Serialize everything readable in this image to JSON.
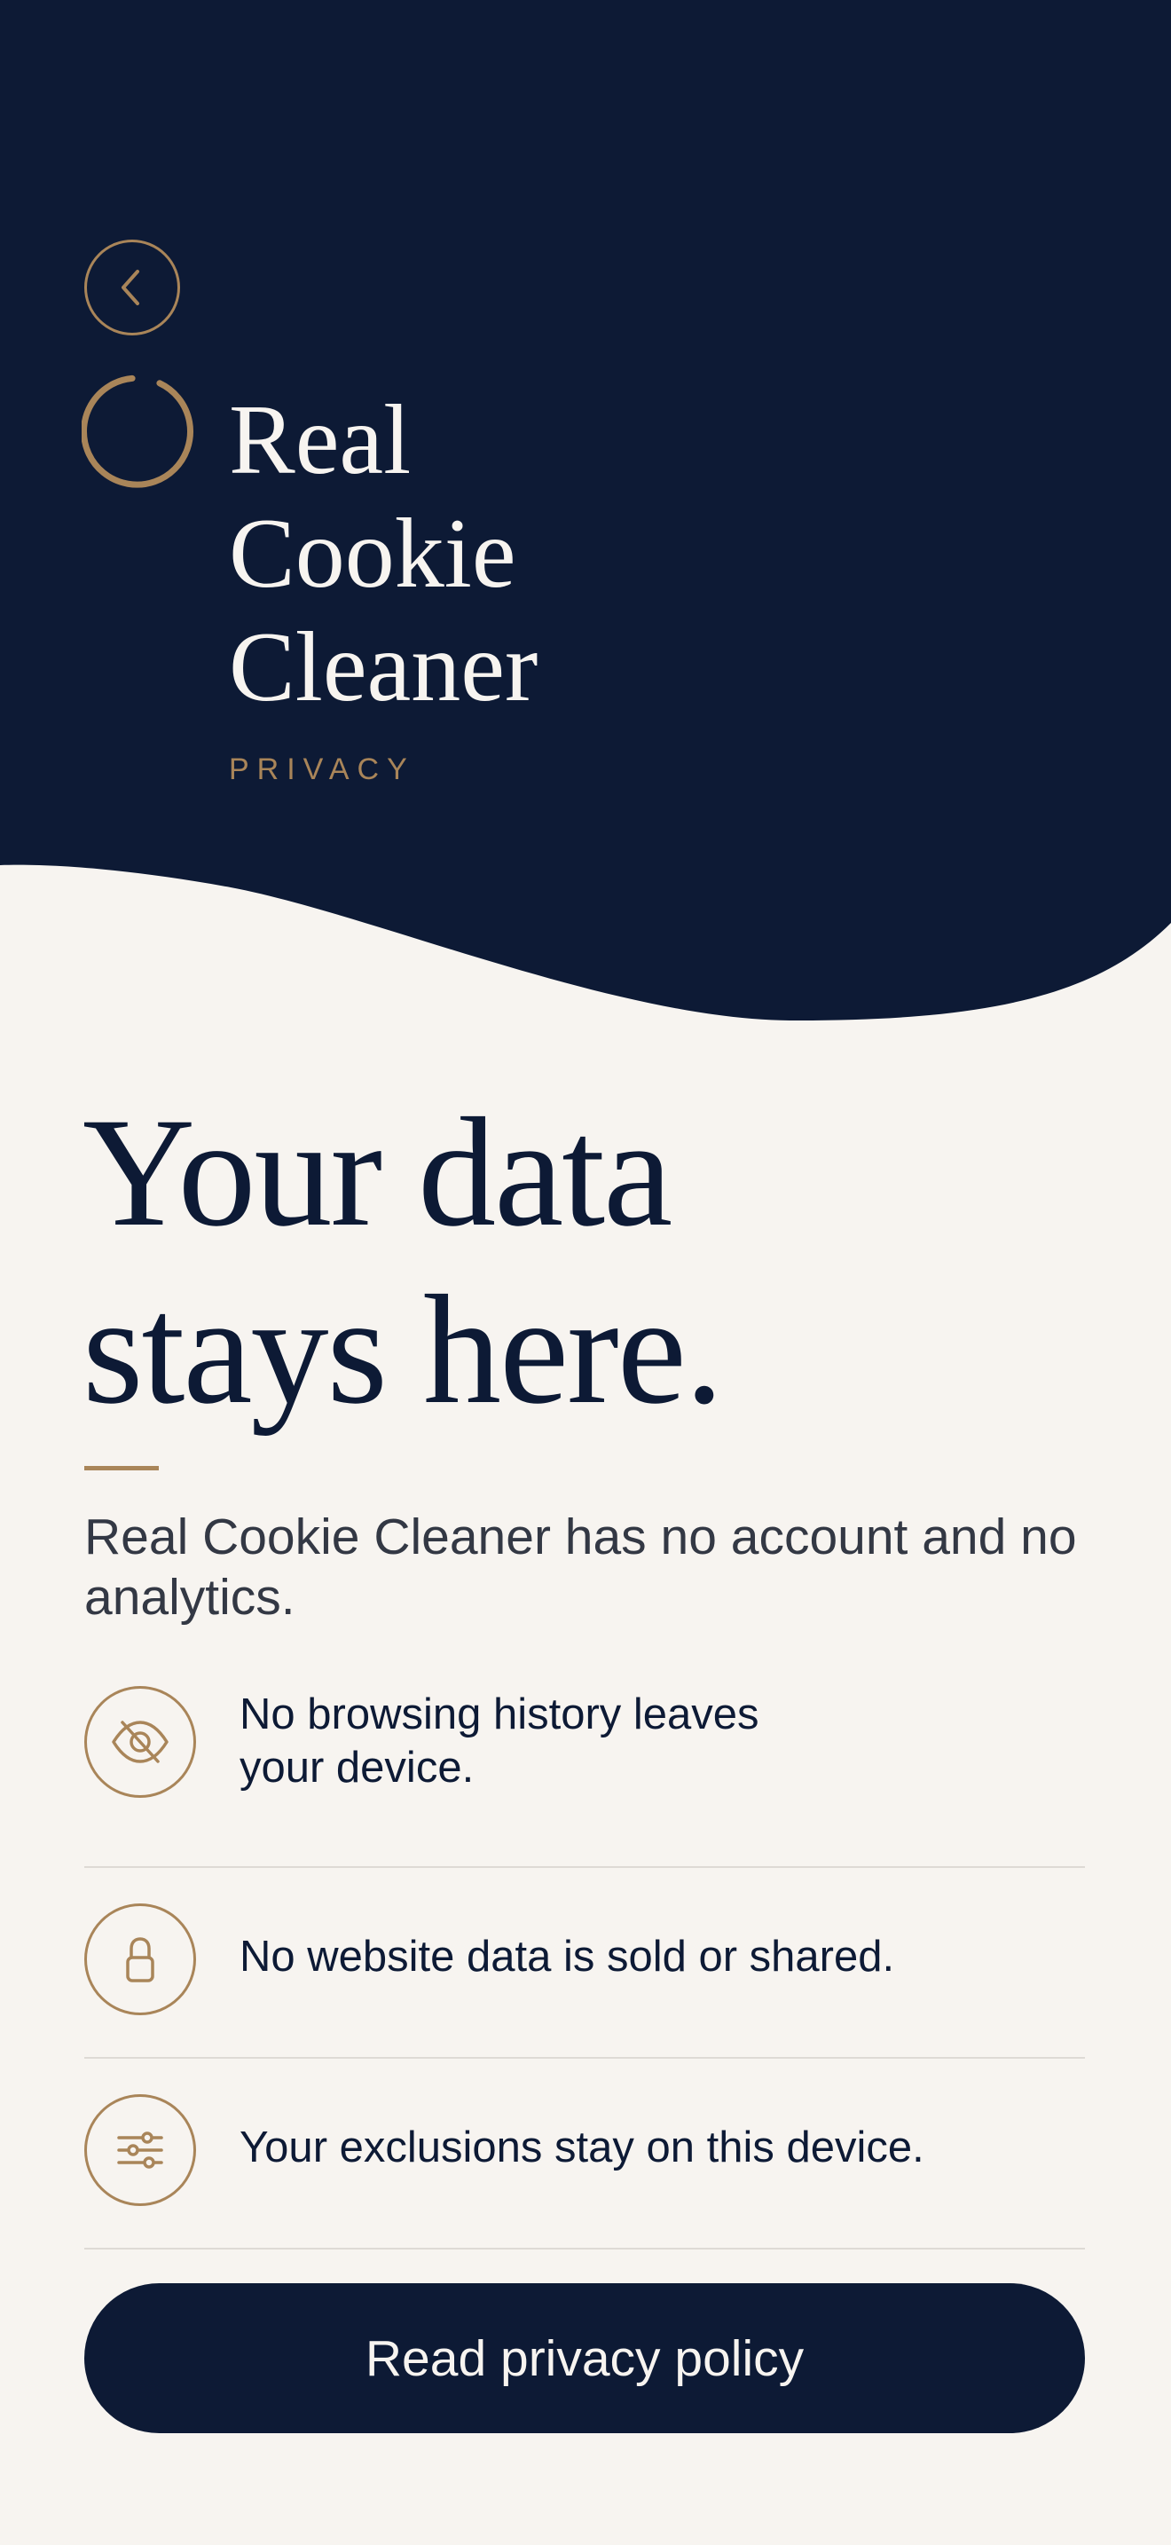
{
  "colors": {
    "navy": "#0d1a35",
    "gold": "#a98559",
    "cream": "#f7f4f0",
    "divider": "#dedad5"
  },
  "header": {
    "back_icon": "chevron-left-icon",
    "logo_icon": "ring-logo-icon",
    "app_name_lines": [
      "Real",
      "Cookie",
      "Cleaner"
    ],
    "category": "PRIVACY"
  },
  "main": {
    "headline_lines": [
      "Your data",
      "stays here."
    ],
    "intro": "Real Cookie Cleaner has no account and no analytics.",
    "features": [
      {
        "icon": "eye-slash-icon",
        "text": "No browsing history leaves your device."
      },
      {
        "icon": "lock-icon",
        "text": "No website data is sold or shared."
      },
      {
        "icon": "sliders-icon",
        "text": "Your exclusions stay on this device."
      }
    ],
    "cta_label": "Read privacy policy"
  }
}
